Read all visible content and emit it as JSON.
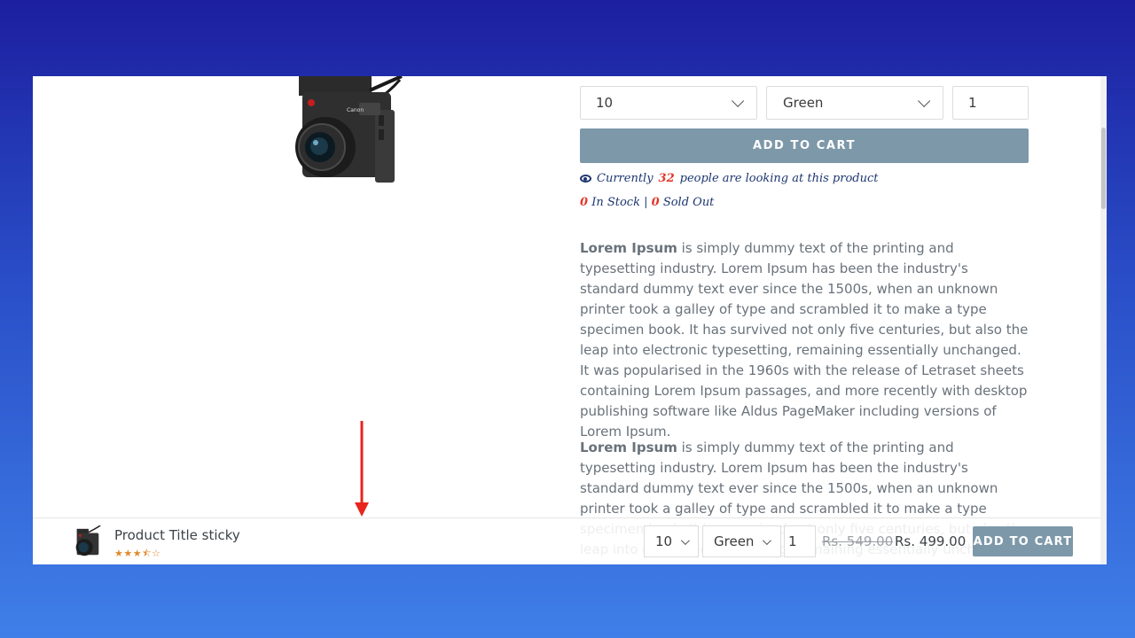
{
  "product_form": {
    "size_value": "10",
    "color_value": "Green",
    "quantity_value": "1",
    "add_to_cart_label": "ADD TO CART"
  },
  "viewers": {
    "prefix": "Currently",
    "count": "32",
    "suffix": "people are looking at this product"
  },
  "stock": {
    "in_stock_count": "0",
    "in_stock_label": "In Stock",
    "separator": "|",
    "sold_out_count": "0",
    "sold_out_label": "Sold Out"
  },
  "description": {
    "p1_bold": "Lorem Ipsum",
    "p1_text": " is simply dummy text of the printing and typesetting industry. Lorem Ipsum has been the industry's standard dummy text ever since the 1500s, when an unknown printer took a galley of type and scrambled it to make a type specimen book. It has survived not only five centuries, but also the leap into electronic typesetting, remaining essentially unchanged. It was popularised in the 1960s with the release of Letraset sheets containing Lorem Ipsum passages, and more recently with desktop publishing software like Aldus PageMaker including versions of Lorem Ipsum.",
    "p2_bold": "Lorem Ipsum",
    "p2_text": " is simply dummy text of the printing and typesetting industry. Lorem Ipsum has been the industry's standard dummy text ever since the 1500s, when an unknown printer took a galley of type and scrambled it to make a type specimen book. It has survived not only five centuries, but also the leap into electronic typesetting, remaining essentially unchanged."
  },
  "sticky_bar": {
    "title": "Product Title sticky",
    "rating": 3.5,
    "stars_display": "★★★⯪☆",
    "size_value": "10",
    "color_value": "Green",
    "quantity_value": "1",
    "old_price": "Rs. 549.00",
    "new_price": "Rs. 499.00",
    "add_to_cart_label": "ADD TO CART"
  },
  "colors": {
    "button_bg": "#7d98a9",
    "accent_red": "#e2362a",
    "navy_text": "#1d3670",
    "annotation_arrow": "#e8241c"
  },
  "icons": [
    "eye-icon",
    "chevron-down-icon",
    "annotation-arrow"
  ]
}
